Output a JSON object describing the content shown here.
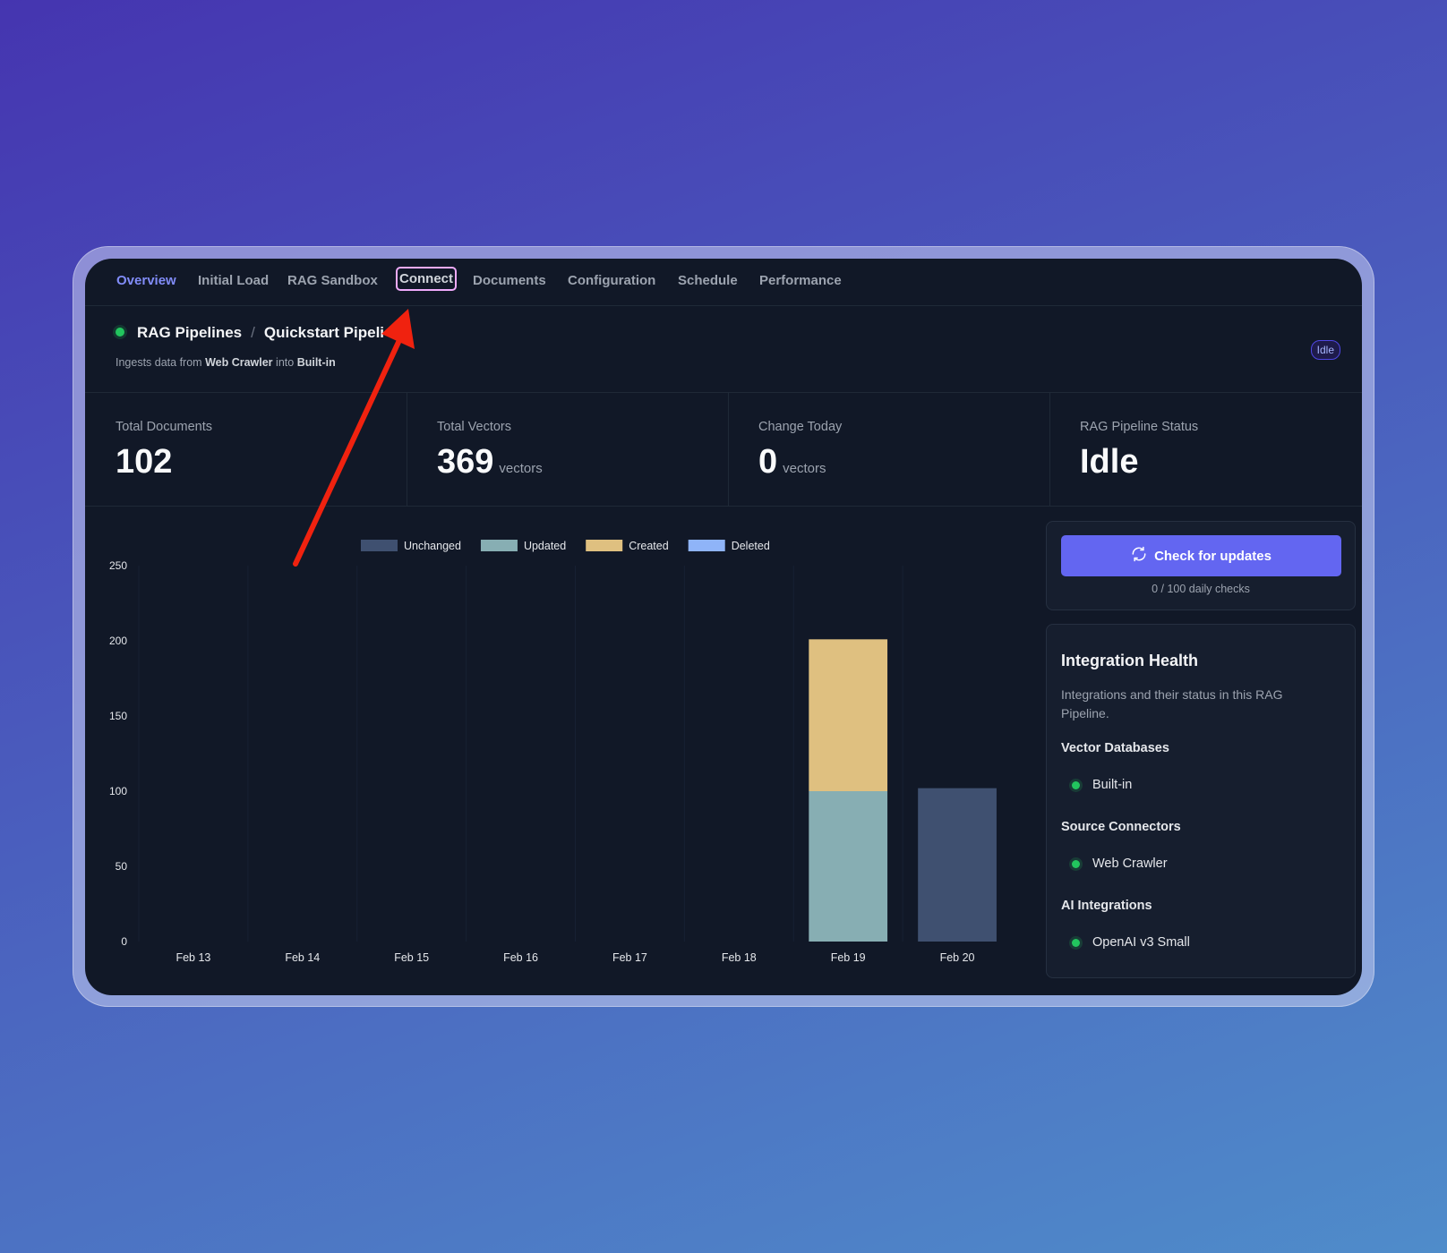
{
  "tabs": [
    {
      "label": "Overview"
    },
    {
      "label": "Initial Load"
    },
    {
      "label": "RAG Sandbox"
    },
    {
      "label": "Connect"
    },
    {
      "label": "Documents"
    },
    {
      "label": "Configuration"
    },
    {
      "label": "Schedule"
    },
    {
      "label": "Performance"
    }
  ],
  "header": {
    "crumb_root": "RAG Pipelines",
    "crumb_separator": "/",
    "crumb_current": "Quickstart Pipeli",
    "sub_prefix": "Ingests data from",
    "sub_source": "Web Crawler",
    "sub_middle": "into",
    "sub_target": "Built-in",
    "status_badge": "Idle"
  },
  "stats": [
    {
      "label": "Total Documents",
      "value": "102",
      "unit": ""
    },
    {
      "label": "Total Vectors",
      "value": "369",
      "unit": "vectors"
    },
    {
      "label": "Change Today",
      "value": "0",
      "unit": "vectors"
    },
    {
      "label": "RAG Pipeline Status",
      "value": "Idle",
      "unit": ""
    }
  ],
  "chart_data": {
    "type": "bar",
    "stacked": true,
    "categories": [
      "Feb 13",
      "Feb 14",
      "Feb 15",
      "Feb 16",
      "Feb 17",
      "Feb 18",
      "Feb 19",
      "Feb 20"
    ],
    "series": [
      {
        "name": "Unchanged",
        "color": "#3f5070",
        "values": [
          0,
          0,
          0,
          0,
          0,
          0,
          0,
          102
        ]
      },
      {
        "name": "Updated",
        "color": "#87aeb3",
        "values": [
          0,
          0,
          0,
          0,
          0,
          0,
          100,
          0
        ]
      },
      {
        "name": "Created",
        "color": "#dfc080",
        "values": [
          0,
          0,
          0,
          0,
          0,
          0,
          101,
          0
        ]
      },
      {
        "name": "Deleted",
        "color": "#8fb4f8",
        "values": [
          0,
          0,
          0,
          0,
          0,
          0,
          0,
          0
        ]
      }
    ],
    "yticks": [
      "0",
      "50",
      "100",
      "150",
      "200",
      "250"
    ],
    "ylim": [
      0,
      250
    ],
    "legend_position": "top"
  },
  "updates": {
    "button_label": "Check for updates",
    "daily_checks": "0 / 100 daily checks"
  },
  "integration_health": {
    "title": "Integration Health",
    "description": "Integrations and their status in this RAG Pipeline.",
    "sections": [
      {
        "title": "Vector Databases",
        "item": "Built-in"
      },
      {
        "title": "Source Connectors",
        "item": "Web Crawler"
      },
      {
        "title": "AI Integrations",
        "item": "OpenAI v3 Small"
      }
    ]
  },
  "colors": {
    "accent": "#6366f1",
    "status_ok": "#22c55e",
    "annotation_arrow": "#f0220f"
  }
}
